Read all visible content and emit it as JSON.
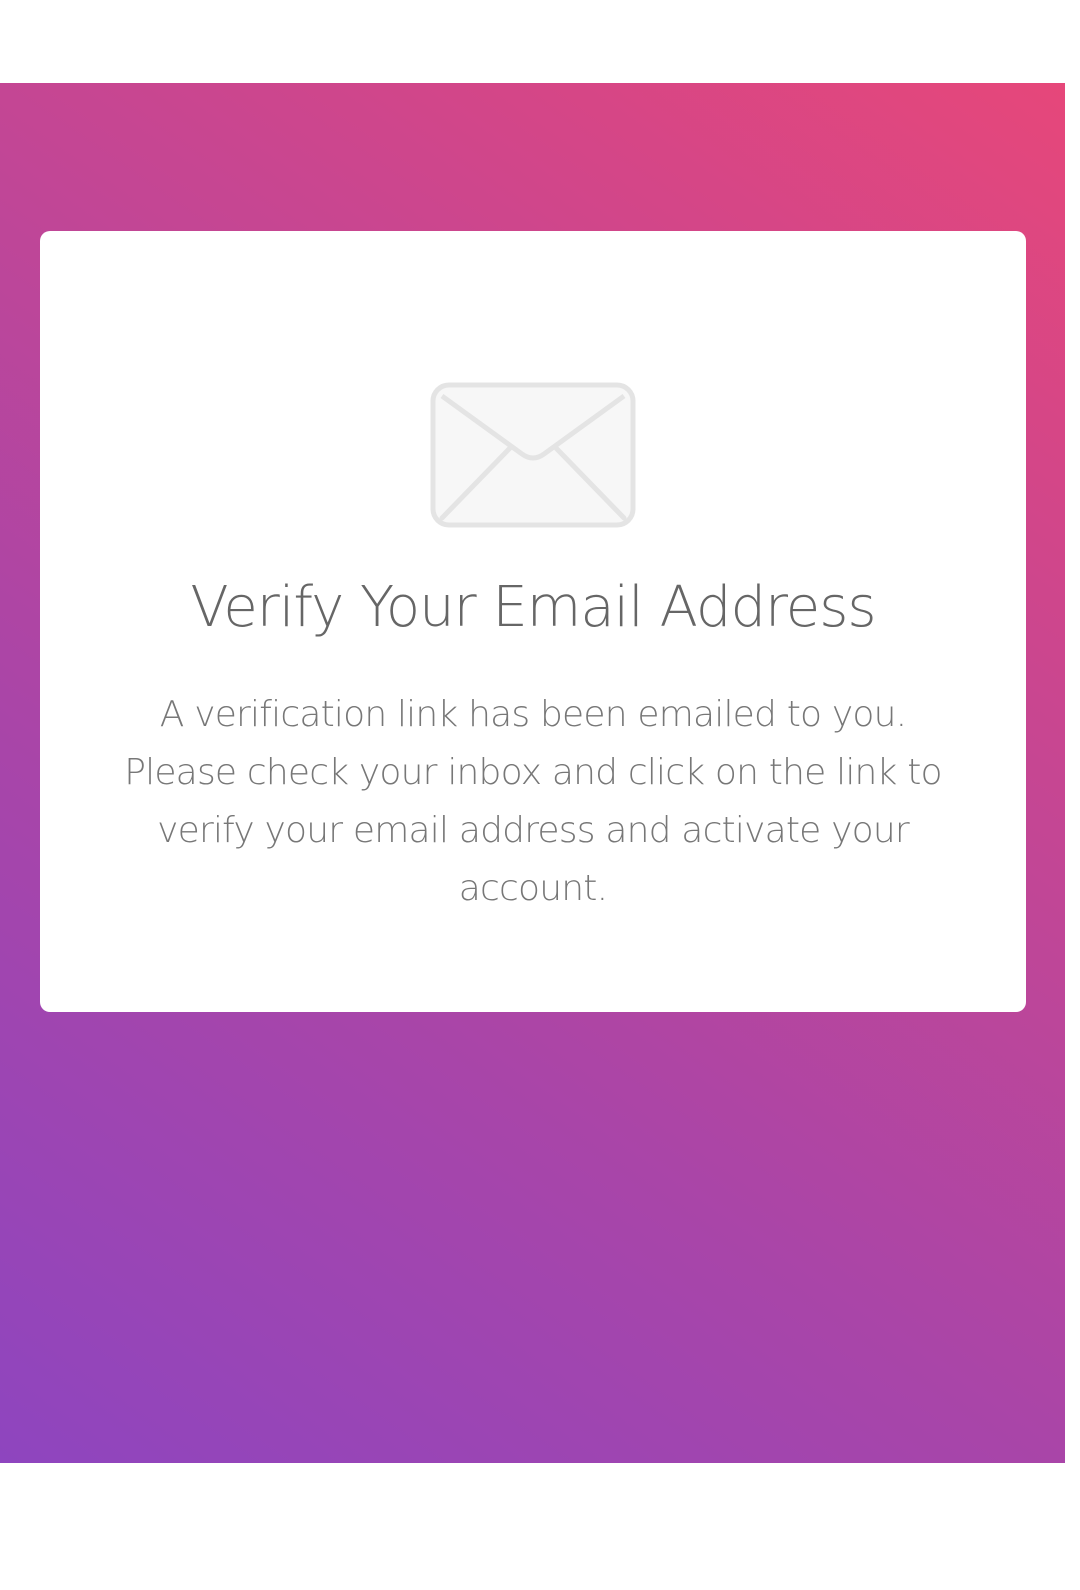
{
  "verification": {
    "icon": "envelope-icon",
    "title": "Verify Your Email Address",
    "message": "A verification link has been emailed to you. Please check your inbox and click on the link to verify your email address and activate your account."
  },
  "colors": {
    "gradient_top_right": "#e6477a",
    "gradient_bottom_left": "#8e45bf",
    "card_background": "#ffffff",
    "text": "#666666",
    "icon": "#e6e6e6"
  }
}
